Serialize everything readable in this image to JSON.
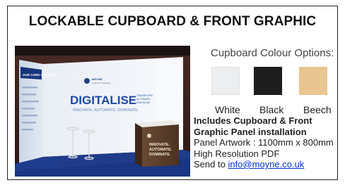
{
  "title": "LOCKABLE CUPBOARD & FRONT GRAPHIC",
  "photo": {
    "wall_title": "OUR CORE SERVICES",
    "brand_name": "MOYNE",
    "brand_tag": "Customer Solutions",
    "headline": "DIGITALISE",
    "headline_side": [
      "TRANSFORM",
      "AUTOMATE",
      "DIGITALISE"
    ],
    "tagline": "INNOVATE. AUTOMATE. DOMINATE.",
    "cube_text": [
      "INNOVATE.",
      "AUTOMATE.",
      "DOMINATE."
    ]
  },
  "options": {
    "title": "Cupboard Colour Options:",
    "swatches": [
      {
        "label": "White",
        "color": "#eceeef"
      },
      {
        "label": "Black",
        "color": "#1d1d1d"
      },
      {
        "label": "Beech",
        "color": "#e8c591"
      }
    ]
  },
  "details": {
    "includes_line1": "Includes Cupboard & Front",
    "includes_line2": "Graphic Panel installation",
    "artwork": "Panel Artwork : 1100mm x 800mm",
    "resolution": "High Resolution PDF",
    "send_prefix": "Send to ",
    "email": "info@moyne.co.uk"
  }
}
